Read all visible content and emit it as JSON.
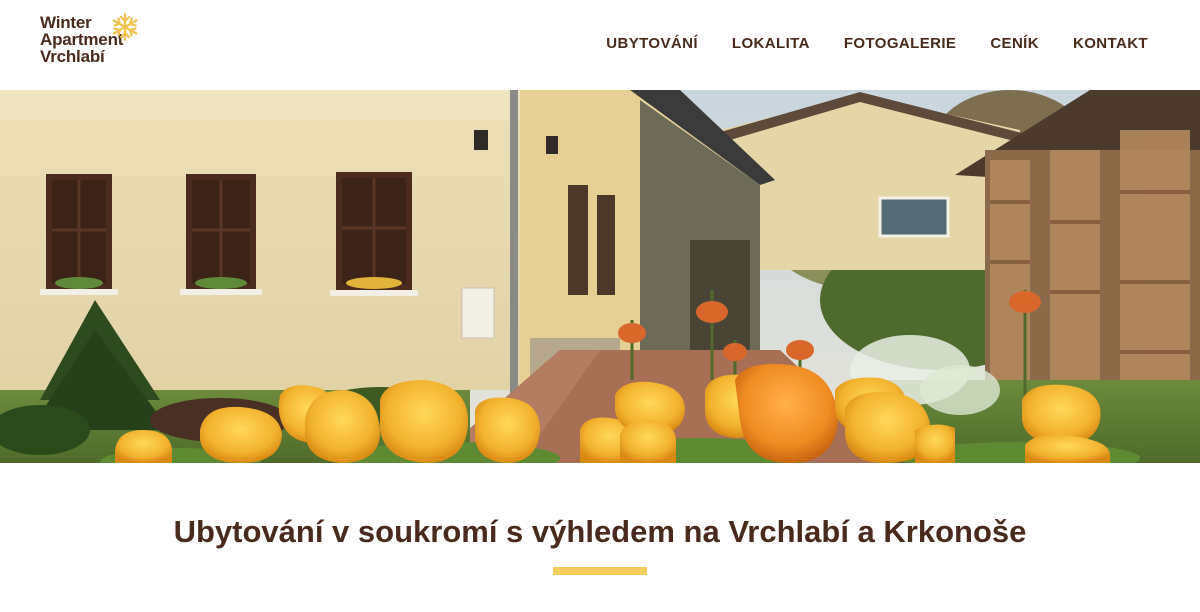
{
  "brand": {
    "line1": "Winter",
    "line2": "Apartment",
    "line3": "Vrchlabí",
    "icon": "snowflake-icon",
    "icon_color": "#f2c14e"
  },
  "nav": {
    "items": [
      {
        "label": "UBYTOVÁNÍ"
      },
      {
        "label": "LOKALITA"
      },
      {
        "label": "FOTOGALERIE"
      },
      {
        "label": "CENÍK"
      },
      {
        "label": "KONTAKT"
      }
    ]
  },
  "hero": {
    "image": "house-garden-tulips-photo"
  },
  "main": {
    "title": "Ubytování v soukromí s výhledem na Vrchlabí a Krkonoše"
  },
  "colors": {
    "text": "#4a2a1c",
    "accent": "#f4cd5c"
  }
}
